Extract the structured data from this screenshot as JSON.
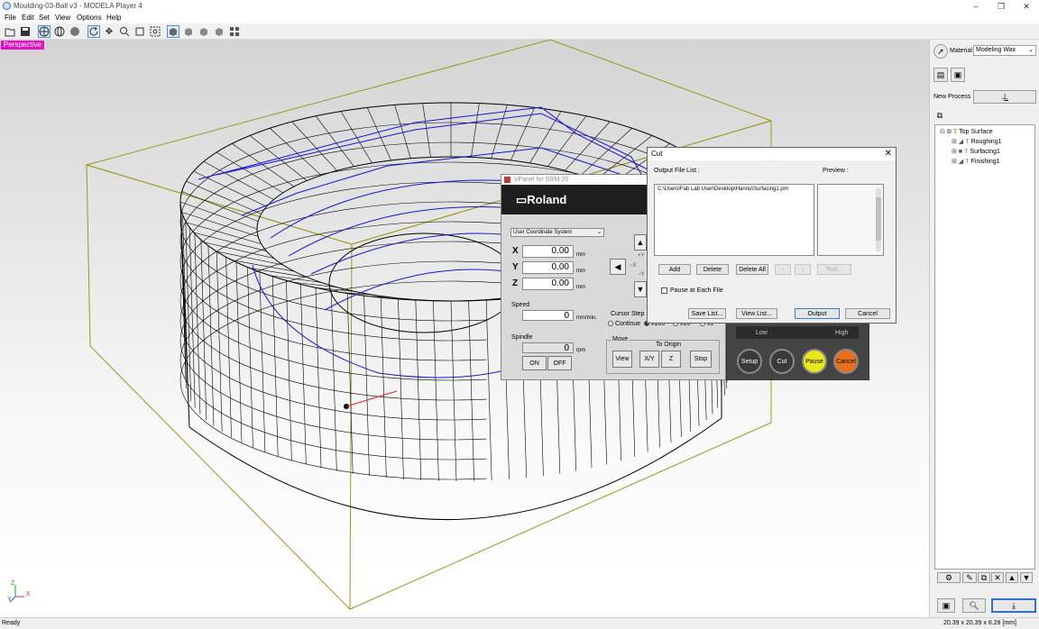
{
  "window": {
    "title": "Moulding-03-Ball v3 - MODELA Player 4",
    "controls": [
      "–",
      "❐",
      "✕"
    ]
  },
  "menu": [
    "File",
    "Edit",
    "Set",
    "View",
    "Options",
    "Help"
  ],
  "toolbar": {
    "icons": [
      "open-icon",
      "save-icon",
      "globe-icon",
      "globe-outline-icon",
      "sphere-icon",
      "rotate-icon",
      "move-icon",
      "zoom-icon",
      "fit-frame-icon",
      "zoom-window-icon",
      "view-front-icon",
      "view-iso-icon",
      "view-side-icon",
      "view-top-icon",
      "view-all-icon"
    ]
  },
  "viewport": {
    "mode_label": "Perspective",
    "axis_labels": {
      "x": "X",
      "y": "Y",
      "z": "Z"
    },
    "colors": {
      "label_bg": "#e510c8",
      "mesh": "#000000",
      "toolpath": "#1515d4",
      "bbox": "#9a9a20"
    }
  },
  "right_panel": {
    "material_label": "Material",
    "material_value": "Modeling Wax",
    "new_process_label": "New Process",
    "tree": [
      {
        "label": "Top Surface",
        "level": 0
      },
      {
        "label": "Roughing1",
        "level": 1
      },
      {
        "label": "Surfacing1",
        "level": 1
      },
      {
        "label": "Finishing1",
        "level": 1
      }
    ]
  },
  "status": {
    "left": "Ready",
    "right": "20.39 x 20.39 x 8.28 [mm]"
  },
  "vpanel": {
    "title": "VPanel for SRM-20",
    "brand": "Roland",
    "coord_system": "User Coordinate System",
    "axes": [
      {
        "name": "X",
        "value": "0.00",
        "unit": "mm"
      },
      {
        "name": "Y",
        "value": "0.00",
        "unit": "mm"
      },
      {
        "name": "Z",
        "value": "0.00",
        "unit": "mm"
      }
    ],
    "speed_label": "Speed",
    "speed_value": "0",
    "speed_unit": "mm/min.",
    "spindle_label": "Spindle",
    "spindle_value": "0",
    "spindle_unit": "rpm",
    "on_label": "ON",
    "off_label": "OFF",
    "cursor_step_label": "Cursor Step",
    "cursor_steps": [
      "Continue",
      "x100",
      "x10",
      "x1"
    ],
    "move_label": "Move",
    "to_origin_label": "To Origin",
    "view_label": "View",
    "xy_label": "X/Y",
    "z_label": "Z",
    "stop_label": "Stop",
    "jog_labels": {
      "plus_y": "+Y",
      "minus_x": "−X",
      "minus_y": "−Y"
    }
  },
  "control": {
    "low_label": "Low",
    "high_label": "High",
    "setup_label": "Setup",
    "cut_label": "Cut",
    "pause_label": "Pause",
    "cancel_label": "Cancel",
    "colors": {
      "pause": "#e8e81a",
      "cancel": "#e8701a"
    }
  },
  "cut_dialog": {
    "title": "Cut",
    "output_file_list_label": "Output File List :",
    "preview_label": "Preview :",
    "files": [
      "C:\\Users\\Fab Lab User\\Desktop\\Hannu\\Surfacing1.prn"
    ],
    "add_label": "Add",
    "delete_label": "Delete",
    "delete_all_label": "Delete All",
    "up_label": "↑",
    "down_label": "↓",
    "test_label": "Test...",
    "pause_each_label": "Pause at Each File",
    "save_list_label": "Save List...",
    "view_list_label": "View List...",
    "output_label": "Output",
    "cancel_label": "Cancel"
  }
}
